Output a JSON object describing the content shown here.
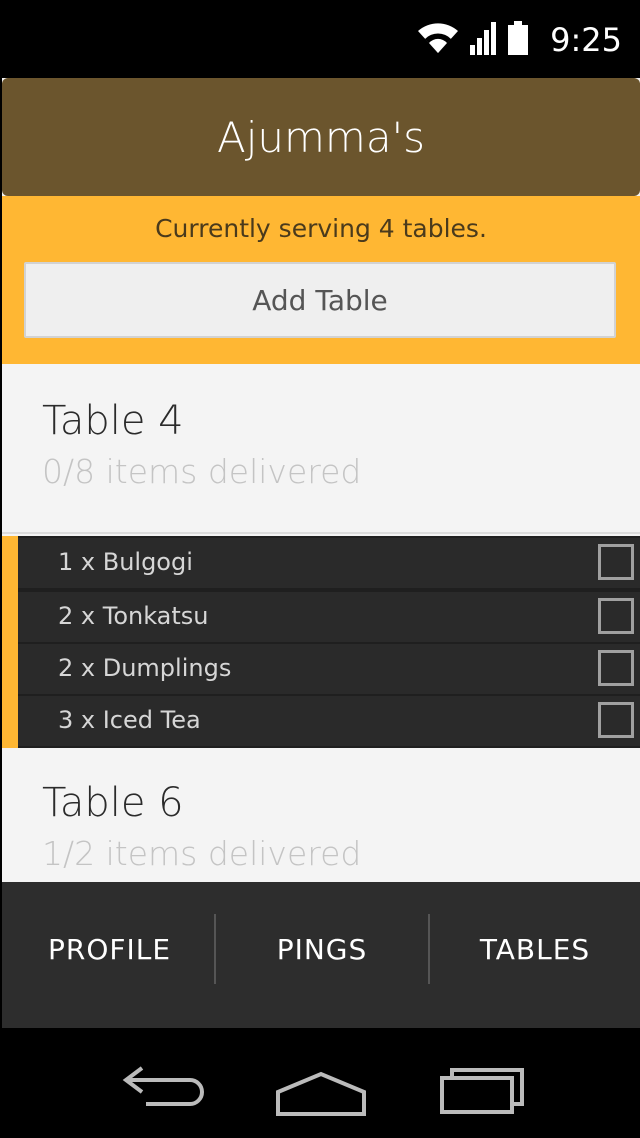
{
  "status": {
    "time": "9:25"
  },
  "app": {
    "title": "Ajumma's"
  },
  "serving": {
    "text": "Currently serving 4 tables.",
    "add_button": "Add Table"
  },
  "tables": [
    {
      "name": "Table 4",
      "status": "0/8 items delivered",
      "items": [
        {
          "label": "1 x Bulgogi",
          "delivered": false
        },
        {
          "label": "2 x Tonkatsu",
          "delivered": false
        },
        {
          "label": "2 x Dumplings",
          "delivered": false
        },
        {
          "label": "3 x Iced Tea",
          "delivered": false
        }
      ]
    },
    {
      "name": "Table 6",
      "status": "1/2 items delivered"
    }
  ],
  "bottom_nav": {
    "tabs": [
      {
        "label": "PROFILE"
      },
      {
        "label": "PINGS"
      },
      {
        "label": "TABLES"
      }
    ]
  },
  "colors": {
    "appbar": "#6b552d",
    "accent": "#ffb733",
    "dark_panel": "#2a2a2a",
    "nav_bg": "#2d2d2d"
  },
  "icons": {
    "status": [
      "wifi-icon",
      "signal-icon",
      "battery-icon"
    ],
    "system_nav": [
      "back-icon",
      "home-icon",
      "recents-icon"
    ]
  }
}
